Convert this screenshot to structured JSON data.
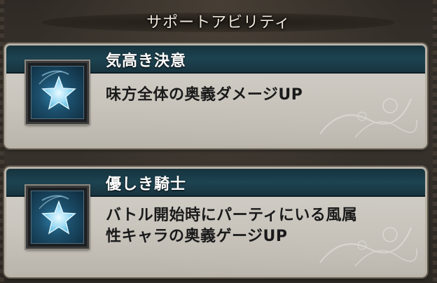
{
  "section_title": "サポートアビリティ",
  "abilities": [
    {
      "name": "気高き決意",
      "description": "味方全体の奥義ダメージUP",
      "icon": "star-icon"
    },
    {
      "name": "優しき騎士",
      "description_line1": "バトル開始時にパーティにいる風属",
      "description_line2": "性キャラの奥義ゲージUP",
      "icon": "star-icon"
    }
  ],
  "colors": {
    "header_bar": "#1d4350",
    "card_body": "#c9c5bd",
    "icon_glow": "#7fd0f0"
  }
}
